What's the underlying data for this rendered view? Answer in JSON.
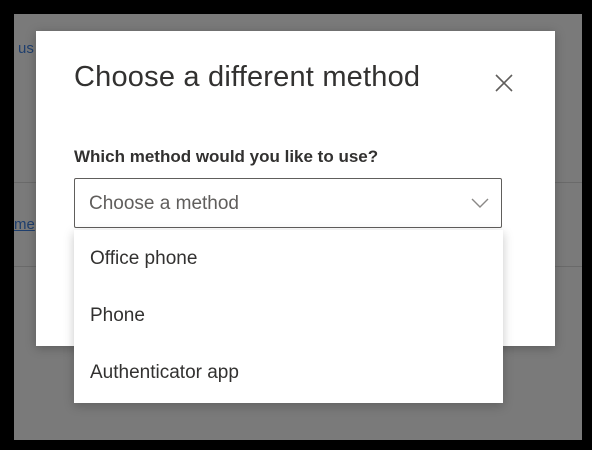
{
  "background": {
    "fragment_top": "us",
    "fragment_middle": "me"
  },
  "modal": {
    "title": "Choose a different method",
    "close_icon": "close-icon",
    "field_label": "Which method would you like to use?",
    "select": {
      "value": "Choose a method",
      "icon": "chevron-down-icon"
    }
  },
  "dropdown": {
    "options": [
      {
        "label": "Office phone"
      },
      {
        "label": "Phone"
      },
      {
        "label": "Authenticator app"
      }
    ]
  },
  "colors": {
    "frame": "#000000",
    "overlay": "#7a7a7a",
    "modal_bg": "#ffffff",
    "text": "#323130",
    "placeholder": "#605e5c"
  }
}
